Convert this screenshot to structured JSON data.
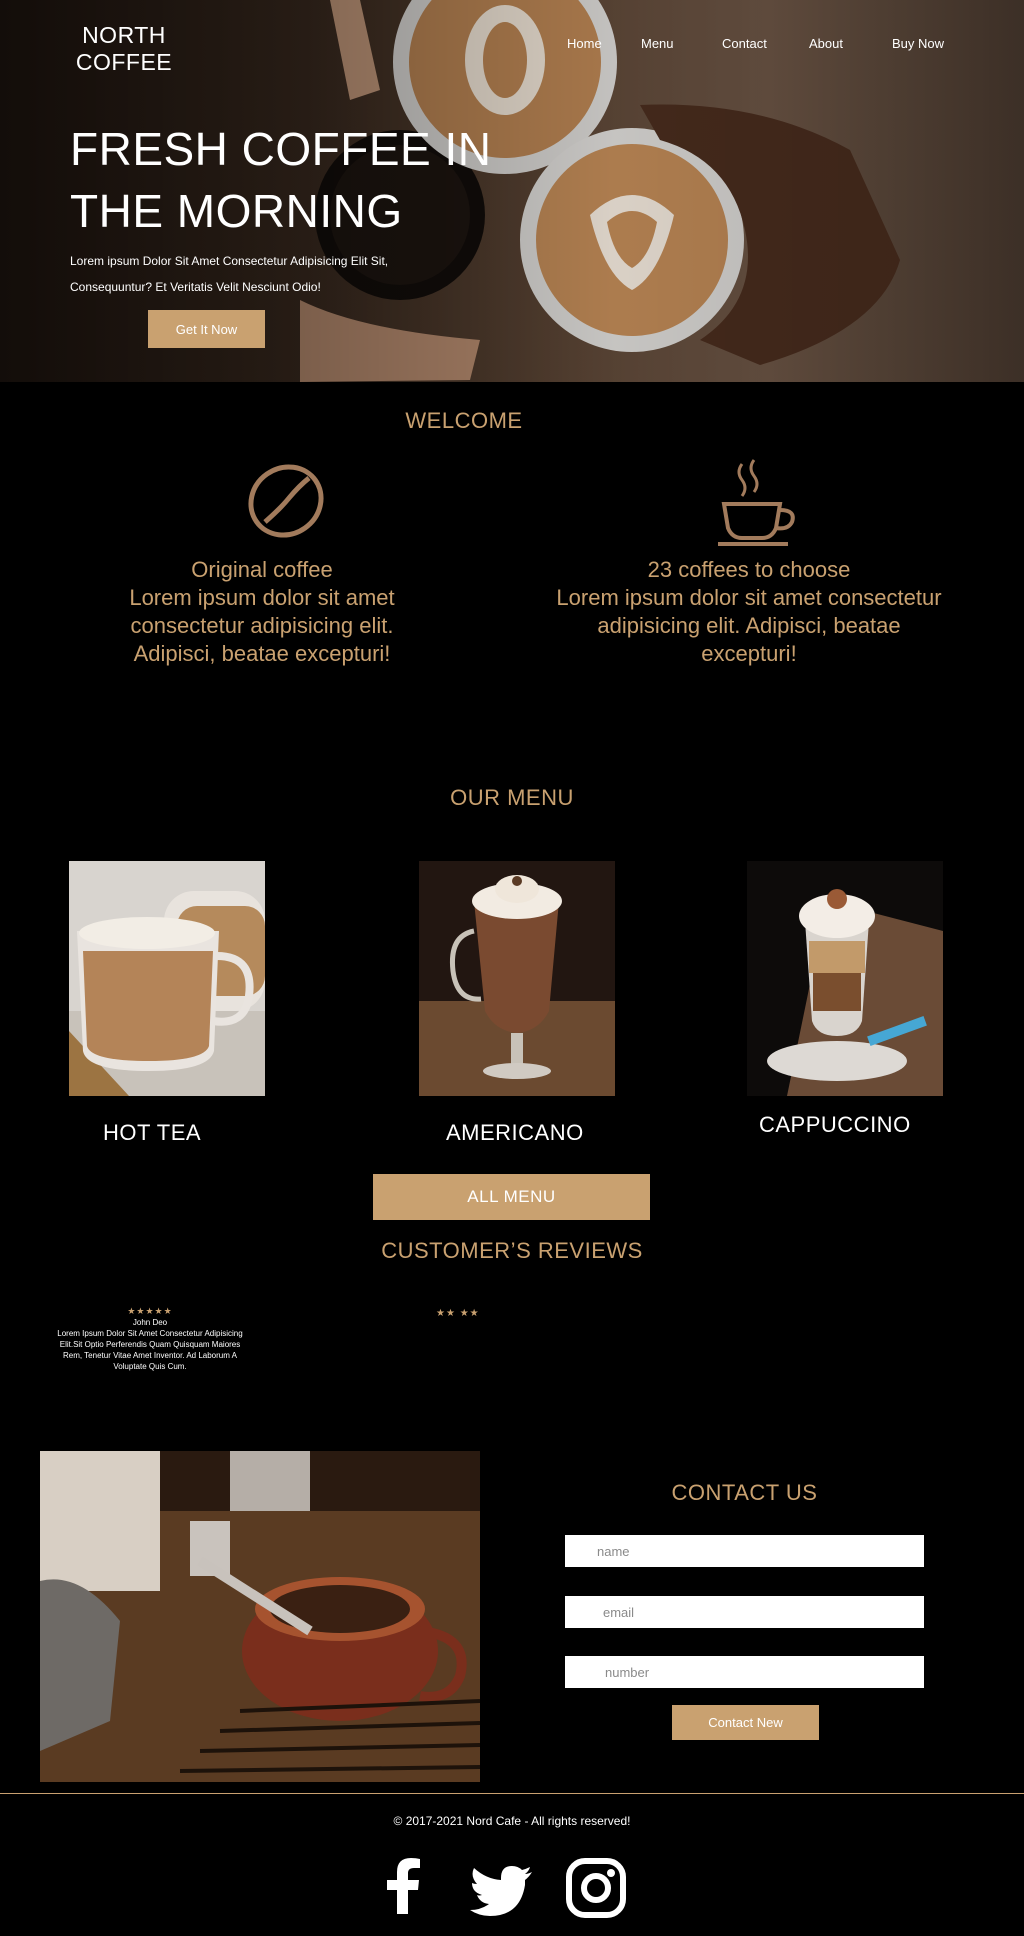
{
  "brand": {
    "line1": "NORTH",
    "line2": "COFFEE"
  },
  "nav": [
    "Home",
    "Menu",
    "Contact",
    "About",
    "Buy Now"
  ],
  "hero": {
    "title_line1": "FRESH COFFEE IN",
    "title_line2": "THE MORNING",
    "subtitle_line1": "Lorem ipsum Dolor Sit Amet Consectetur Adipisicing Elit Sit,",
    "subtitle_line2": "Consequuntur? Et Veritatis Velit Nesciunt Odio!",
    "cta": "Get It Now"
  },
  "welcome": {
    "title": "WELCOME",
    "features": [
      {
        "icon": "coffee-bean-icon",
        "heading": "Original coffee",
        "text": "Lorem ipsum dolor sit amet consectetur adipisicing elit. Adipisci, beatae excepturi!"
      },
      {
        "icon": "coffee-cup-icon",
        "heading": "23 coffees to choose",
        "text": "Lorem ipsum dolor sit amet consectetur adipisicing elit. Adipisci, beatae excepturi!"
      }
    ]
  },
  "menu": {
    "title": "OUR MENU",
    "items": [
      "HOT TEA",
      "AMERICANO",
      "CAPPUCCINO"
    ],
    "all_button": "ALL MENU"
  },
  "reviews": {
    "title": "CUSTOMER’S REVIEWS",
    "items": [
      {
        "stars": "★★★★★",
        "name": "John Deo",
        "text": "Lorem Ipsum Dolor Sit Amet Consectetur Adipisicing Elit.Sit Optio Perferendis Quam Quisquam Maiores Rem, Tenetur Vitae Amet Inventor. Ad Laborum A Voluptate Quis Cum."
      },
      {
        "stars": "★★  ★★"
      }
    ]
  },
  "contact": {
    "title": "CONTACT US",
    "placeholders": {
      "name": "name",
      "email": "email",
      "number": "number"
    },
    "submit": "Contact New"
  },
  "footer": {
    "copyright": "© 2017-2021 Nord Cafe - All rights reserved!",
    "social": [
      "facebook-icon",
      "twitter-icon",
      "instagram-icon"
    ]
  },
  "colors": {
    "accent": "#c9a170",
    "background": "#000000"
  }
}
